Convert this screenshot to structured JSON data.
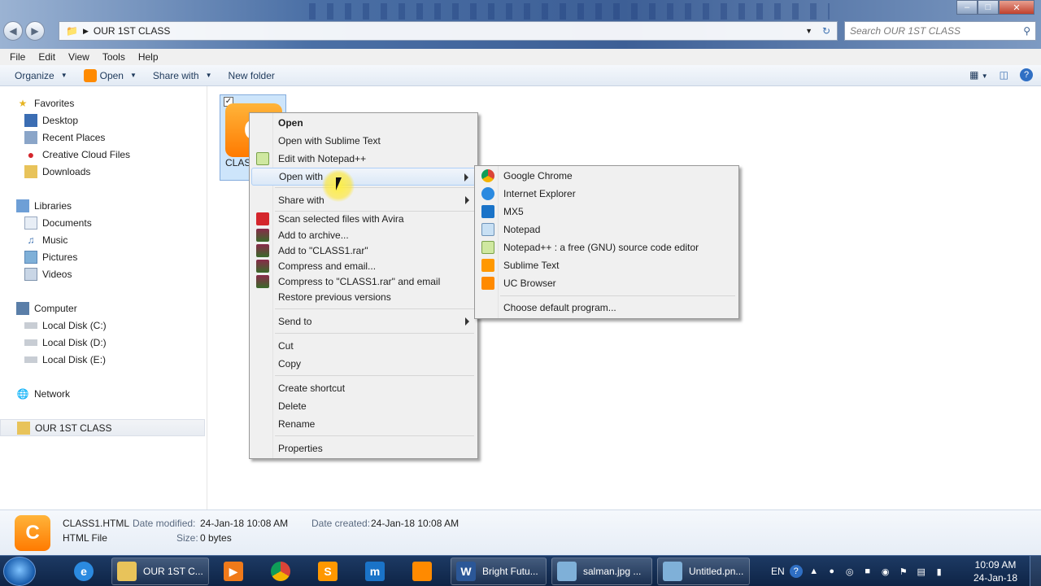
{
  "window": {
    "minimize_icon": "minimize-icon",
    "maximize_icon": "maximize-icon",
    "close_icon": "close-icon"
  },
  "address": {
    "path": "OUR 1ST CLASS",
    "search_placeholder": "Search OUR 1ST CLASS"
  },
  "menubar": [
    "File",
    "Edit",
    "View",
    "Tools",
    "Help"
  ],
  "toolbar": {
    "organize": "Organize",
    "open": "Open",
    "share_with": "Share with",
    "new_folder": "New folder"
  },
  "nav": {
    "favorites": "Favorites",
    "favorites_items": [
      "Desktop",
      "Recent Places",
      "Creative Cloud Files",
      "Downloads"
    ],
    "libraries": "Libraries",
    "libraries_items": [
      "Documents",
      "Music",
      "Pictures",
      "Videos"
    ],
    "computer": "Computer",
    "computer_items": [
      "Local Disk (C:)",
      "Local Disk (D:)",
      "Local Disk (E:)"
    ],
    "network": "Network",
    "selected_folder": "OUR 1ST CLASS"
  },
  "file": {
    "label": "CLASS1.HTML",
    "icon_letter": "C"
  },
  "context_menu": {
    "items": [
      "Open",
      "Open with Sublime Text",
      "Edit with Notepad++",
      "Open with",
      "Share with",
      "Scan selected files with Avira",
      "Add to archive...",
      "Add to \"CLASS1.rar\"",
      "Compress and email...",
      "Compress to \"CLASS1.rar\" and email",
      "Restore previous versions",
      "Send to",
      "Cut",
      "Copy",
      "Create shortcut",
      "Delete",
      "Rename",
      "Properties"
    ]
  },
  "open_with_menu": {
    "items": [
      "Google Chrome",
      "Internet Explorer",
      "MX5",
      "Notepad",
      "Notepad++ : a free (GNU) source code editor",
      "Sublime Text",
      "UC Browser",
      "Choose default program..."
    ]
  },
  "details": {
    "name": "CLASS1.HTML",
    "type": "HTML File",
    "modified_label": "Date modified:",
    "modified_value": "24-Jan-18 10:08 AM",
    "size_label": "Size:",
    "size_value": "0 bytes",
    "created_label": "Date created:",
    "created_value": "24-Jan-18 10:08 AM"
  },
  "taskbar": {
    "explorer_window": "OUR 1ST C...",
    "word_window": "Bright Futu...",
    "image1_window": "salman.jpg ...",
    "image2_window": "Untitled.pn...",
    "language": "EN",
    "time": "10:09 AM",
    "date": "24-Jan-18"
  },
  "colors": {
    "selection_blue": "#cde5fb",
    "menu_highlight": "#dbe8f7",
    "taskbar": "#0e2446",
    "uc_orange": "#ff7a00"
  }
}
